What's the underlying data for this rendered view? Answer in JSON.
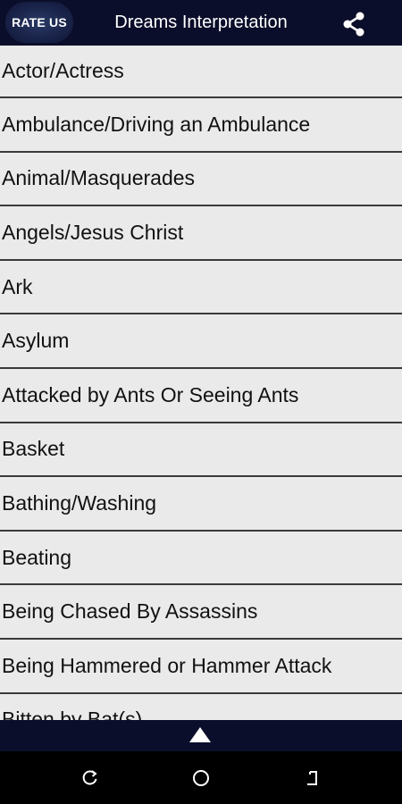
{
  "appbar": {
    "rate_label": "RATE US",
    "title": "Dreams Interpretation",
    "share_icon": "share-icon",
    "background": "#0b0e2a"
  },
  "list": {
    "items": [
      "Actor/Actress",
      "Ambulance/Driving an Ambulance",
      "Animal/Masquerades",
      "Angels/Jesus Christ",
      "Ark",
      "Asylum",
      "Attacked by Ants Or Seeing Ants",
      "Basket",
      "Bathing/Washing",
      "Beating",
      "Being Chased By Assassins",
      "Being Hammered or Hammer Attack",
      "Bitten by Bat(s)"
    ]
  },
  "bottom_bar": {
    "icon": "scroll-up-arrow-icon"
  },
  "navbar": {
    "recent_icon": "recent-apps-icon",
    "home_icon": "home-icon",
    "back_icon": "back-icon"
  }
}
